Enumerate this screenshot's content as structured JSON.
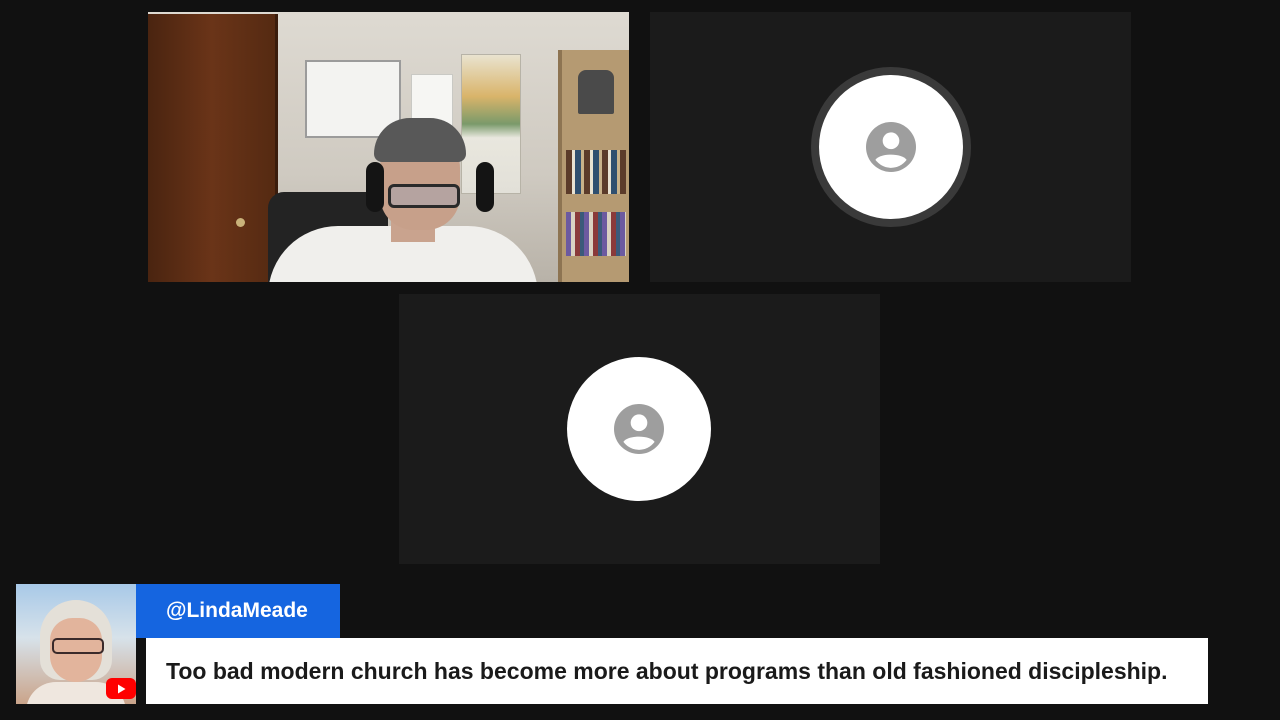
{
  "tiles": [
    {
      "kind": "video",
      "icon": "webcam-video-feed"
    },
    {
      "kind": "avatar",
      "icon": "account-circle-icon"
    },
    {
      "kind": "avatar",
      "icon": "account-circle-icon"
    }
  ],
  "comment": {
    "author": "@LindaMeade",
    "text": "Too bad modern church has become more about programs than old fashioned discipleship.",
    "platform_icon": "youtube-icon"
  },
  "colors": {
    "background": "#111111",
    "tile": "#1b1b1b",
    "name_box": "#1565e0",
    "text_box": "#ffffff",
    "youtube_red": "#ff0000",
    "avatar_icon": "#9e9e9e"
  }
}
